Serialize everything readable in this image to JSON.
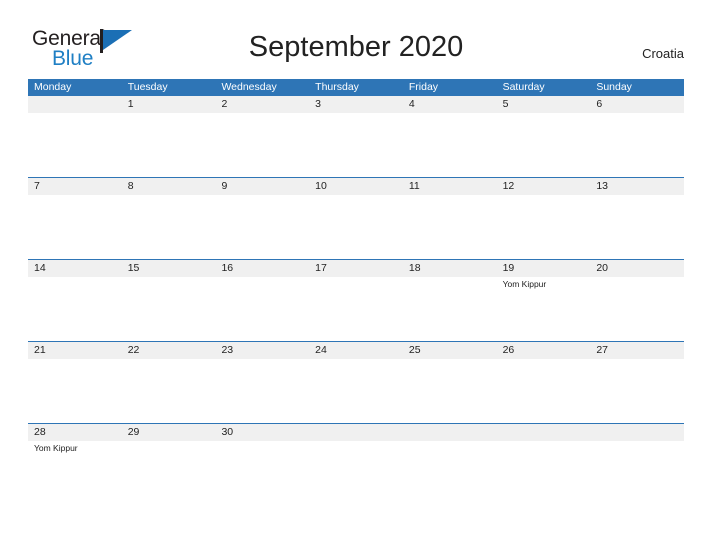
{
  "logo": {
    "word_one": "General",
    "word_two": "Blue",
    "dark_color": "#231f20",
    "blue_color": "#1f7fc4",
    "flag_color": "#1b6fb5"
  },
  "header": {
    "title": "September 2020",
    "region": "Croatia"
  },
  "theme": {
    "header_blue": "#2e75b6",
    "band_gray": "#f0f0f0",
    "text_dark": "#222222",
    "page_background": "#ffffff"
  },
  "calendar": {
    "weekdays": [
      "Monday",
      "Tuesday",
      "Wednesday",
      "Thursday",
      "Friday",
      "Saturday",
      "Sunday"
    ],
    "weeks": [
      [
        {
          "day": "",
          "event": ""
        },
        {
          "day": "1",
          "event": ""
        },
        {
          "day": "2",
          "event": ""
        },
        {
          "day": "3",
          "event": ""
        },
        {
          "day": "4",
          "event": ""
        },
        {
          "day": "5",
          "event": ""
        },
        {
          "day": "6",
          "event": ""
        }
      ],
      [
        {
          "day": "7",
          "event": ""
        },
        {
          "day": "8",
          "event": ""
        },
        {
          "day": "9",
          "event": ""
        },
        {
          "day": "10",
          "event": ""
        },
        {
          "day": "11",
          "event": ""
        },
        {
          "day": "12",
          "event": ""
        },
        {
          "day": "13",
          "event": ""
        }
      ],
      [
        {
          "day": "14",
          "event": ""
        },
        {
          "day": "15",
          "event": ""
        },
        {
          "day": "16",
          "event": ""
        },
        {
          "day": "17",
          "event": ""
        },
        {
          "day": "18",
          "event": ""
        },
        {
          "day": "19",
          "event": "Yom Kippur"
        },
        {
          "day": "20",
          "event": ""
        }
      ],
      [
        {
          "day": "21",
          "event": ""
        },
        {
          "day": "22",
          "event": ""
        },
        {
          "day": "23",
          "event": ""
        },
        {
          "day": "24",
          "event": ""
        },
        {
          "day": "25",
          "event": ""
        },
        {
          "day": "26",
          "event": ""
        },
        {
          "day": "27",
          "event": ""
        }
      ],
      [
        {
          "day": "28",
          "event": "Yom Kippur"
        },
        {
          "day": "29",
          "event": ""
        },
        {
          "day": "30",
          "event": ""
        },
        {
          "day": "",
          "event": ""
        },
        {
          "day": "",
          "event": ""
        },
        {
          "day": "",
          "event": ""
        },
        {
          "day": "",
          "event": ""
        }
      ]
    ]
  }
}
